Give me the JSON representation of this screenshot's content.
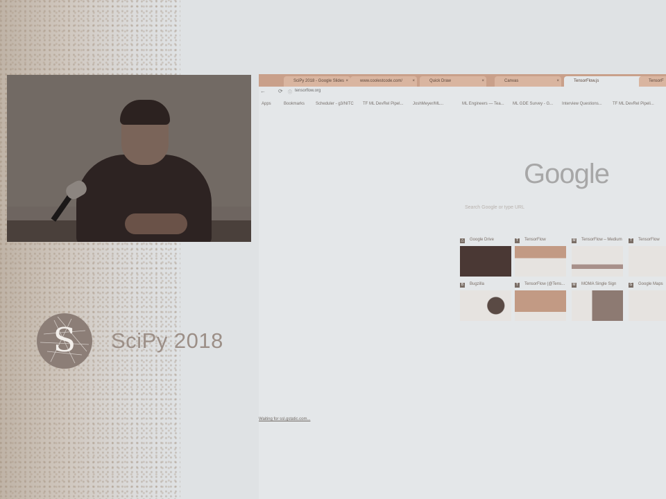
{
  "logo": {
    "title": "SciPy 2018",
    "glyph": "S"
  },
  "browser": {
    "tabs": [
      {
        "label": "SciPy 2018 - Google Slides",
        "active": false
      },
      {
        "label": "www.coolestcode.com/",
        "active": false
      },
      {
        "label": "Quick Draw",
        "active": false
      },
      {
        "label": "Canvas",
        "active": false
      },
      {
        "label": "TensorFlow.js",
        "active": true
      },
      {
        "label": "TensorF",
        "active": false
      }
    ],
    "url": "tensorflow.org",
    "bookmarks": [
      "Apps",
      "Bookmarks",
      "Scheduler - g3/NITC",
      "TF ML DevRel Pipel...",
      "JoshMeyer/ML...",
      "ML Engineers — Tea...",
      "ML GDE Survey - G...",
      "Interview Questions...",
      "TF ML DevRel Pipeli..."
    ],
    "google_logo": "Google",
    "search_placeholder": "Search Google or type URL",
    "tiles": [
      {
        "title": "Google Drive",
        "fav": "△"
      },
      {
        "title": "TensorFlow",
        "fav": "T"
      },
      {
        "title": "TensorFlow – Medium",
        "fav": "M"
      },
      {
        "title": "TensorFlow",
        "fav": "T"
      },
      {
        "title": "Bugzilla",
        "fav": "B"
      },
      {
        "title": "TensorFlow (@Tens...",
        "fav": "T"
      },
      {
        "title": "MOMA Single Sign",
        "fav": "M"
      },
      {
        "title": "Google Maps",
        "fav": "G"
      }
    ],
    "status_text": "Waiting for ssl.gstatic.com..."
  }
}
